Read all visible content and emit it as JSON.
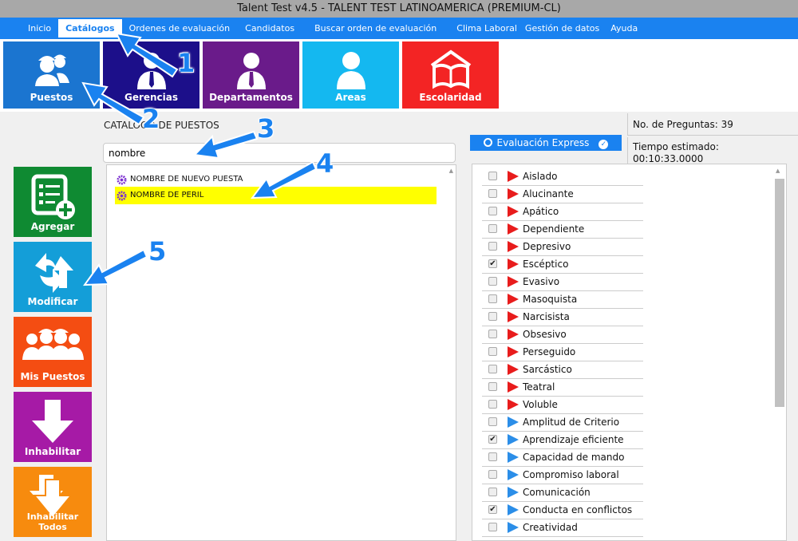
{
  "window": {
    "title": "Talent Test v4.5 - TALENT TEST LATINOAMERICA (PREMIUM-CL)"
  },
  "menu": [
    {
      "label": "Inicio"
    },
    {
      "label": "Catálogos",
      "active": true
    },
    {
      "label": "Ordenes de evaluación"
    },
    {
      "label": "Candidatos"
    },
    {
      "label": "Buscar orden de evaluación"
    },
    {
      "label": "Clima Laboral"
    },
    {
      "label": "Gestión de datos"
    },
    {
      "label": "Ayuda"
    }
  ],
  "ribbon": [
    {
      "label": "Puestos",
      "color": "#1b75d0",
      "icon": "workers-icon"
    },
    {
      "label": "Gerencias",
      "color": "#1c0f8a",
      "icon": "manager-icon"
    },
    {
      "label": "Departamentos",
      "color": "#6a1b8a",
      "icon": "department-icon"
    },
    {
      "label": "Areas",
      "color": "#14b8f0",
      "icon": "person-icon"
    },
    {
      "label": "Escolaridad",
      "color": "#f32424",
      "icon": "school-icon"
    }
  ],
  "catalog": {
    "title": "CATALOGO DE PUESTOS",
    "search_value": "nombre",
    "items": [
      {
        "label": "NOMBRE DE NUEVO PUESTA",
        "selected": false
      },
      {
        "label": "NOMBRE DE PERIL",
        "selected": true
      }
    ]
  },
  "sidebar": [
    {
      "label": "Agregar",
      "color": "#0f8a32",
      "icon": "add-form-icon"
    },
    {
      "label": "Modificar",
      "color": "#149ed8",
      "icon": "refresh-arrows-icon"
    },
    {
      "label": "Mis Puestos",
      "color": "#f44d12",
      "icon": "team-icon"
    },
    {
      "label": "Inhabilitar",
      "color": "#a61aa6",
      "icon": "down-arrow-icon"
    },
    {
      "label": "Inhabilitar Todos",
      "color": "#f78b0e",
      "icon": "double-down-arrow-icon"
    }
  ],
  "eval_button": {
    "label": "Evaluación Express"
  },
  "info": {
    "preguntas": "No. de Preguntas: 39",
    "tiempo_label": "Tiempo estimado:",
    "tiempo_value": "00:10:33.0000"
  },
  "questions": [
    {
      "label": "Aislado",
      "checked": false,
      "color": "#e81c1c"
    },
    {
      "label": "Alucinante",
      "checked": false,
      "color": "#e81c1c"
    },
    {
      "label": "Apático",
      "checked": false,
      "color": "#e81c1c"
    },
    {
      "label": "Dependiente",
      "checked": false,
      "color": "#e81c1c"
    },
    {
      "label": "Depresivo",
      "checked": false,
      "color": "#e81c1c"
    },
    {
      "label": "Escéptico",
      "checked": true,
      "color": "#e81c1c"
    },
    {
      "label": "Evasivo",
      "checked": false,
      "color": "#e81c1c"
    },
    {
      "label": "Masoquista",
      "checked": false,
      "color": "#e81c1c"
    },
    {
      "label": "Narcisista",
      "checked": false,
      "color": "#e81c1c"
    },
    {
      "label": "Obsesivo",
      "checked": false,
      "color": "#e81c1c"
    },
    {
      "label": "Perseguido",
      "checked": false,
      "color": "#e81c1c"
    },
    {
      "label": "Sarcástico",
      "checked": false,
      "color": "#e81c1c"
    },
    {
      "label": "Teatral",
      "checked": false,
      "color": "#e81c1c"
    },
    {
      "label": "Voluble",
      "checked": false,
      "color": "#e81c1c"
    },
    {
      "label": "Amplitud de Criterio",
      "checked": false,
      "color": "#2b8ee8"
    },
    {
      "label": "Aprendizaje eficiente",
      "checked": true,
      "color": "#2b8ee8"
    },
    {
      "label": "Capacidad de mando",
      "checked": false,
      "color": "#2b8ee8"
    },
    {
      "label": "Compromiso laboral",
      "checked": false,
      "color": "#2b8ee8"
    },
    {
      "label": "Comunicación",
      "checked": false,
      "color": "#2b8ee8"
    },
    {
      "label": "Conducta en conflictos",
      "checked": true,
      "color": "#2b8ee8"
    },
    {
      "label": "Creatividad",
      "checked": false,
      "color": "#2b8ee8"
    }
  ],
  "annotations": [
    "1",
    "2",
    "3",
    "4",
    "5"
  ],
  "accent": "#1a82f0"
}
